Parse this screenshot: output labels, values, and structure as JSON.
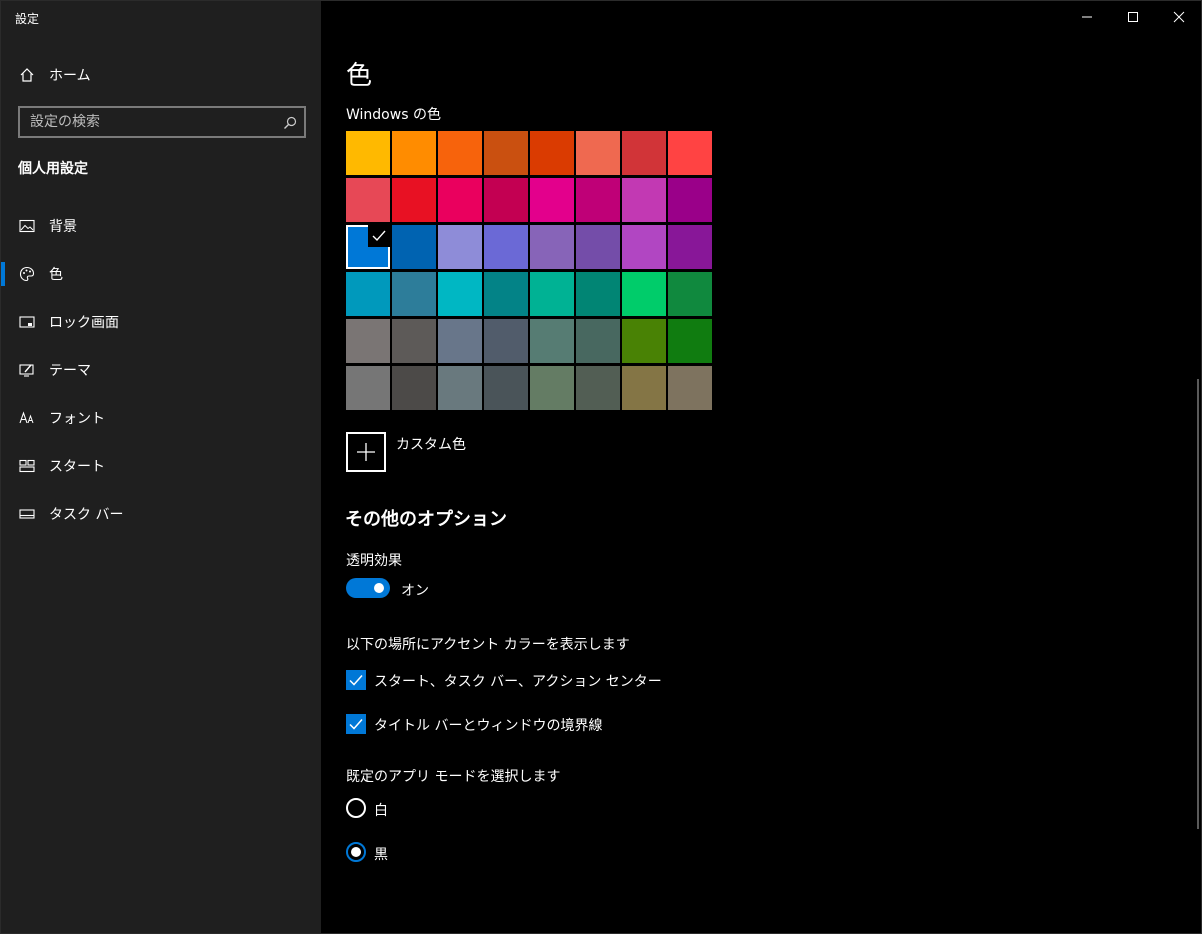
{
  "window": {
    "title": "設定"
  },
  "sidebar": {
    "home_label": "ホーム",
    "search_placeholder": "設定の検索",
    "section_heading": "個人用設定",
    "items": [
      {
        "label": "背景",
        "icon": "picture-icon",
        "active": false
      },
      {
        "label": "色",
        "icon": "palette-icon",
        "active": true
      },
      {
        "label": "ロック画面",
        "icon": "lock-screen-icon",
        "active": false
      },
      {
        "label": "テーマ",
        "icon": "theme-icon",
        "active": false
      },
      {
        "label": "フォント",
        "icon": "font-icon",
        "active": false
      },
      {
        "label": "スタート",
        "icon": "start-icon",
        "active": false
      },
      {
        "label": "タスク バー",
        "icon": "taskbar-icon",
        "active": false
      }
    ]
  },
  "main": {
    "title": "色",
    "windows_colors_label": "Windows の色",
    "swatches": [
      [
        "#FFB900",
        "#FF8C00",
        "#F7630C",
        "#CA5010",
        "#DA3B01",
        "#EF6950",
        "#D13438",
        "#FF4343"
      ],
      [
        "#E74856",
        "#E81123",
        "#EA005E",
        "#C30052",
        "#E3008C",
        "#BF0077",
        "#C239B3",
        "#9A0089"
      ],
      [
        "#0078D7",
        "#0063B1",
        "#8E8CD8",
        "#6B69D6",
        "#8764B8",
        "#744DA9",
        "#B146C2",
        "#881798"
      ],
      [
        "#0099BC",
        "#2D7D9A",
        "#00B7C3",
        "#038387",
        "#00B294",
        "#018574",
        "#00CC6A",
        "#10893E"
      ],
      [
        "#7A7574",
        "#5D5A58",
        "#68768A",
        "#515C6B",
        "#567C73",
        "#486860",
        "#498205",
        "#107C10"
      ],
      [
        "#767676",
        "#4C4A48",
        "#69797E",
        "#4A5459",
        "#647C64",
        "#525E54",
        "#847545",
        "#7E735F"
      ]
    ],
    "selected_swatch": {
      "row": 2,
      "col": 0
    },
    "custom_color_label": "カスタム色",
    "more_options_heading": "その他のオプション",
    "transparency": {
      "label": "透明効果",
      "state_label": "オン",
      "on": true
    },
    "accent_surfaces": {
      "label": "以下の場所にアクセント カラーを表示します",
      "options": [
        {
          "label": "スタート、タスク バー、アクション センター",
          "checked": true
        },
        {
          "label": "タイトル バーとウィンドウの境界線",
          "checked": true
        }
      ]
    },
    "app_mode": {
      "label": "既定のアプリ モードを選択します",
      "options": [
        {
          "label": "白",
          "checked": false
        },
        {
          "label": "黒",
          "checked": true
        }
      ]
    }
  },
  "colors": {
    "accent": "#0078d7",
    "sidebar_bg": "#1f1f1f",
    "content_bg": "#000000"
  }
}
